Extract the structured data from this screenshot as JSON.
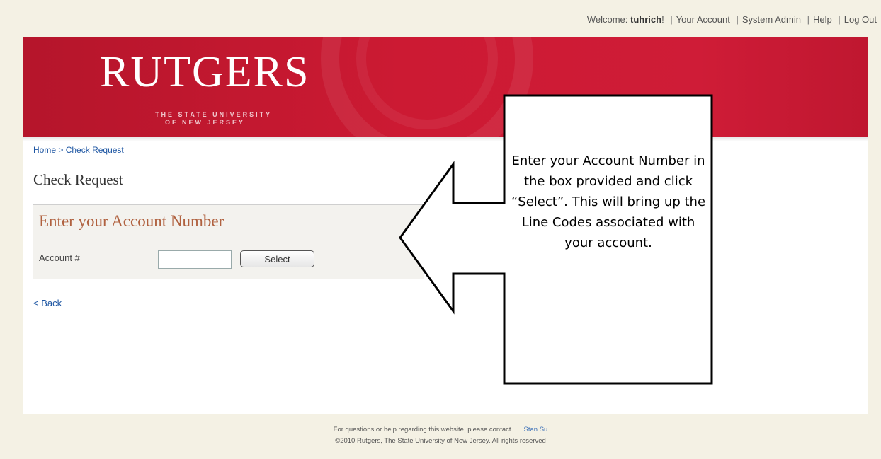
{
  "topnav": {
    "welcome_prefix": "Welcome: ",
    "username": "tuhrich",
    "welcome_suffix": "!",
    "links": [
      "Your Account",
      "System Admin",
      "Help",
      "Log Out"
    ]
  },
  "banner": {
    "logo_main": "RUTGERS",
    "logo_line1": "THE STATE UNIVERSITY",
    "logo_line2": "OF NEW JERSEY"
  },
  "breadcrumb": {
    "home": "Home",
    "separator": ">",
    "current": "Check Request"
  },
  "page_title": "Check Request",
  "panel": {
    "title": "Enter your Account Number",
    "account_label": "Account #",
    "account_value": "",
    "select_label": "Select"
  },
  "back_link": "< Back",
  "callout": {
    "text": "Enter your Account Number in the box provided and click “Select”. This will bring up the Line Codes associated with your account."
  },
  "footer": {
    "help_text": "For questions or help regarding this website, please contact",
    "contact_name": "Stan Su",
    "copyright": "©2010 Rutgers, The State University of New Jersey. All rights reserved"
  },
  "colors": {
    "banner_red": "#cc1a33",
    "link_blue": "#1f57a3",
    "panel_title": "#b0613f",
    "page_bg": "#f4f1e4"
  }
}
